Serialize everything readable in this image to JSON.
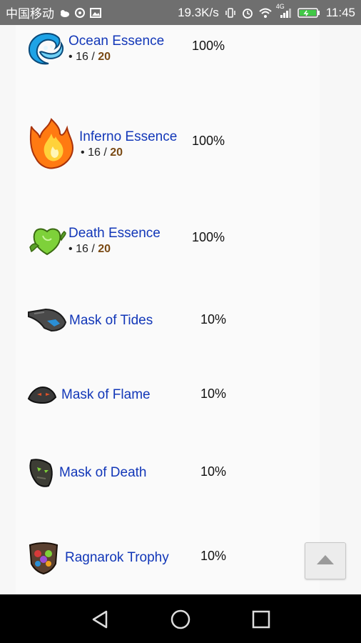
{
  "status_bar": {
    "carrier": "中国移动",
    "speed": "19.3K/s",
    "network": "4G",
    "time": "11:45"
  },
  "items": [
    {
      "name": "Ocean Essence",
      "count": "16",
      "max": "20",
      "chance": "100%",
      "icon": "ocean-essence-icon"
    },
    {
      "name": "Inferno Essence",
      "count": "16",
      "max": "20",
      "chance": "100%",
      "icon": "inferno-essence-icon"
    },
    {
      "name": "Death Essence",
      "count": "16",
      "max": "20",
      "chance": "100%",
      "icon": "death-essence-icon"
    },
    {
      "name": "Mask of Tides",
      "chance": "10%",
      "icon": "mask-of-tides-icon"
    },
    {
      "name": "Mask of Flame",
      "chance": "10%",
      "icon": "mask-of-flame-icon"
    },
    {
      "name": "Mask of Death",
      "chance": "10%",
      "icon": "mask-of-death-icon"
    },
    {
      "name": "Ragnarok Trophy",
      "chance": "10%",
      "icon": "ragnarok-trophy-icon"
    }
  ],
  "count_separator": "/",
  "bullet": "•",
  "scroll_top_button": {
    "icon": "arrow-up-icon"
  },
  "nav": {
    "back": "back-icon",
    "home": "home-icon",
    "recents": "recents-icon"
  },
  "colors": {
    "link": "#1237b8",
    "max_count": "#7a4a14",
    "status_bar": "#6f6f6f"
  }
}
